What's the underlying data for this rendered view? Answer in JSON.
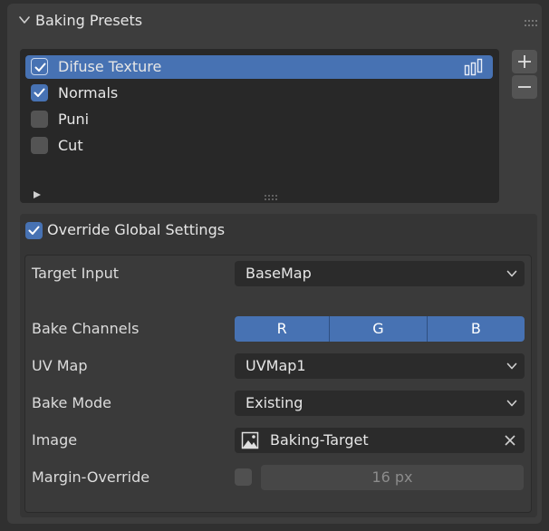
{
  "panel": {
    "title": "Baking Presets"
  },
  "presets": {
    "items": [
      {
        "label": "Difuse Texture",
        "checked": true,
        "selected": true
      },
      {
        "label": "Normals",
        "checked": true,
        "selected": false
      },
      {
        "label": "Puni",
        "checked": false,
        "selected": false
      },
      {
        "label": "Cut",
        "checked": false,
        "selected": false
      }
    ],
    "add_icon": "plus-icon",
    "remove_icon": "minus-icon"
  },
  "override": {
    "label": "Override Global Settings",
    "checked": true
  },
  "settings": {
    "target_input": {
      "label": "Target Input",
      "value": "BaseMap"
    },
    "bake_channels": {
      "label": "Bake Channels",
      "channels": [
        "R",
        "G",
        "B"
      ]
    },
    "uv_map": {
      "label": "UV Map",
      "value": "UVMap1"
    },
    "bake_mode": {
      "label": "Bake Mode",
      "value": "Existing"
    },
    "image": {
      "label": "Image",
      "value": "Baking-Target"
    },
    "margin": {
      "label": "Margin-Override",
      "value": "16 px",
      "checked": false
    }
  },
  "colors": {
    "accent": "#4772b3",
    "panel": "#3d3d3d",
    "field": "#2b2b2b"
  }
}
